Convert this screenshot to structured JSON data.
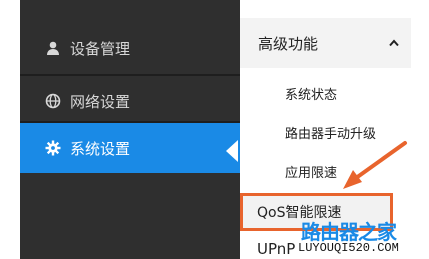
{
  "sidebar": {
    "items": [
      {
        "label": "设备管理",
        "icon": "user-icon"
      },
      {
        "label": "网络设置",
        "icon": "globe-icon"
      },
      {
        "label": "系统设置",
        "icon": "gear-icon",
        "active": true
      }
    ]
  },
  "panel": {
    "header": "高级功能",
    "sub_items": [
      "系统状态",
      "路由器手动升级",
      "应用限速",
      "QoS智能限速",
      "UPnP"
    ]
  },
  "watermark": {
    "site_name": "路由器之家",
    "url": "LUYOUQI520.COM"
  },
  "colors": {
    "sidebar_bg": "#2f2f2f",
    "active_bg": "#1a8ae6",
    "highlight": "#e8642d"
  }
}
